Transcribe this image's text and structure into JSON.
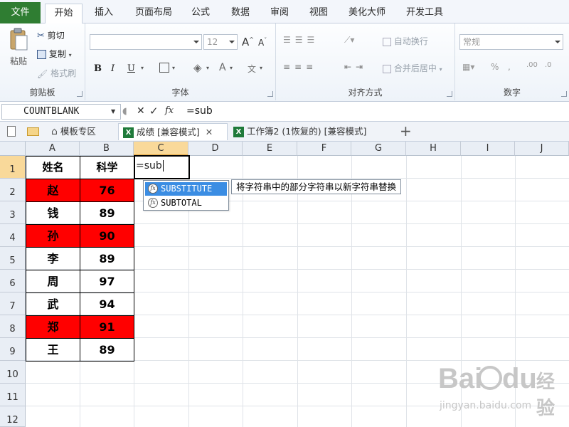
{
  "ribbon_tabs": [
    "文件",
    "开始",
    "插入",
    "页面布局",
    "公式",
    "数据",
    "审阅",
    "视图",
    "美化大师",
    "开发工具"
  ],
  "clipboard": {
    "paste": "粘贴",
    "cut": "剪切",
    "copy": "复制",
    "format_painter": "格式刷",
    "label": "剪贴板"
  },
  "font": {
    "name": "",
    "size": "12",
    "bold": "B",
    "italic": "I",
    "underline": "U",
    "label": "字体"
  },
  "alignment": {
    "wrap": "自动换行",
    "merge": "合并后居中",
    "label": "对齐方式"
  },
  "number": {
    "format": "常规",
    "label": "数字"
  },
  "formula_bar": {
    "name_box": "COUNTBLANK",
    "fx": "fx",
    "formula": "=sub"
  },
  "doc_tabs": {
    "template": "模板专区",
    "tab1": "成绩  [兼容模式]",
    "tab2": "工作簿2 (1恢复的)  [兼容模式]",
    "plus": "+"
  },
  "columns": [
    "A",
    "B",
    "C",
    "D",
    "E",
    "F",
    "G",
    "H",
    "I",
    "J"
  ],
  "rows": [
    "1",
    "2",
    "3",
    "4",
    "5",
    "6",
    "7",
    "8",
    "9",
    "10",
    "11",
    "12"
  ],
  "table": {
    "header": [
      "姓名",
      "科学"
    ],
    "rows": [
      {
        "name": "赵",
        "score": "76",
        "highlight": true
      },
      {
        "name": "钱",
        "score": "89",
        "highlight": false
      },
      {
        "name": "孙",
        "score": "90",
        "highlight": true
      },
      {
        "name": "李",
        "score": "89",
        "highlight": false
      },
      {
        "name": "周",
        "score": "97",
        "highlight": false
      },
      {
        "name": "武",
        "score": "94",
        "highlight": false
      },
      {
        "name": "郑",
        "score": "91",
        "highlight": true
      },
      {
        "name": "王",
        "score": "89",
        "highlight": false
      }
    ]
  },
  "active_cell": {
    "ref": "C1",
    "text": "=sub"
  },
  "autocomplete": {
    "items": [
      "SUBSTITUTE",
      "SUBTOTAL"
    ],
    "selected": "SUBSTITUTE",
    "tooltip": "将字符串中的部分字符串以新字符串替换"
  },
  "watermark": {
    "line1": "Bai",
    "line2": "du",
    "line3": "经验",
    "line4": "jingyan.baidu.com"
  },
  "colors": {
    "file_tab": "#2f7d32",
    "highlight_red": "#ff0000",
    "selected_header": "#f9d99a",
    "autocomplete_selected": "#3b8de3"
  },
  "icons": [
    "paste-icon",
    "cut-icon",
    "copy-icon",
    "format-painter-icon",
    "new-doc-icon",
    "folder-icon",
    "home-icon",
    "excel-icon",
    "fx-icon"
  ]
}
